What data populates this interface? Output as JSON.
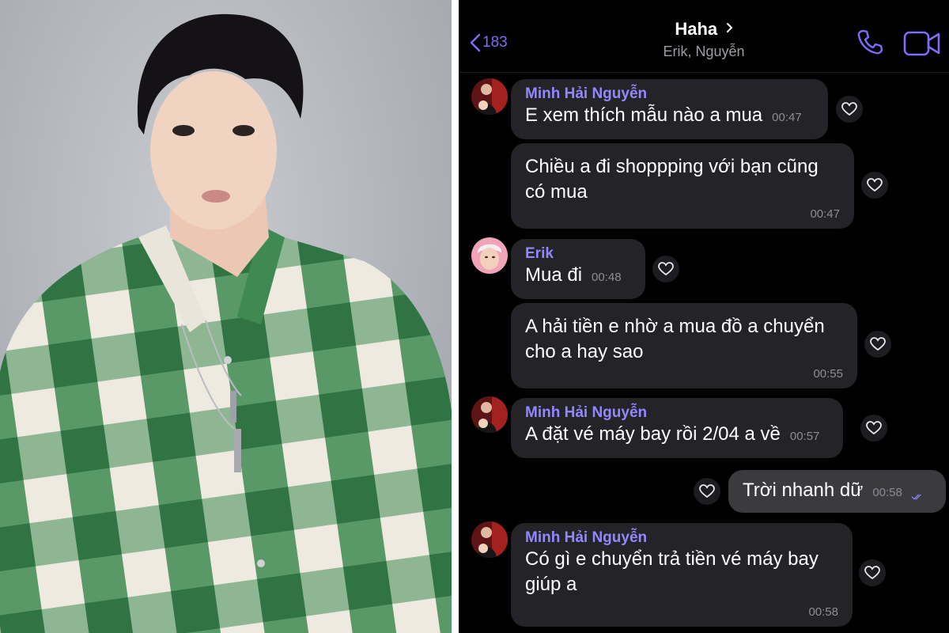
{
  "chat": {
    "back_count": "183",
    "title": "Haha",
    "subtitle": "Erik, Nguyễn",
    "accent_color": "#7d6cf5",
    "messages": [
      {
        "sender": "Minh Hải Nguyễn",
        "text": "E xem thích mẫu nào a mua",
        "time": "00:47"
      },
      {
        "sender": "",
        "text": "Chiều a đi shoppping với bạn cũng có mua",
        "time": "00:47"
      },
      {
        "sender": "Erik",
        "text": "Mua đi",
        "time": "00:48"
      },
      {
        "sender": "",
        "text": "A hải tiền e nhờ a mua đồ a chuyển cho a hay sao",
        "time": "00:55"
      },
      {
        "sender": "Minh Hải Nguyễn",
        "text": "A đặt vé máy bay rồi 2/04 a về",
        "time": "00:57"
      },
      {
        "sender": "",
        "text": "Trời nhanh dữ",
        "time": "00:58",
        "outgoing": true
      },
      {
        "sender": "Minh Hải Nguyễn",
        "text": "Có gì e chuyển trả tiền vé máy bay giúp a",
        "time": "00:58"
      }
    ]
  }
}
